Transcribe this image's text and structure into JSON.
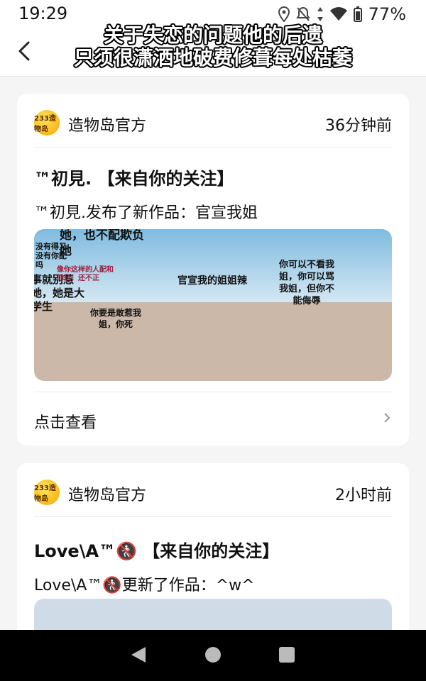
{
  "status": {
    "time": "19:29",
    "battery": "77%"
  },
  "header": {
    "title_line1": "关于失恋的问题他的后遗",
    "title_line2": "只须很潇洒地破费修葺每处枯萎"
  },
  "cards": [
    {
      "source": "造物岛官方",
      "avatar_text": "233造物岛",
      "time": "36分钟前",
      "title": "™初見. 【来自你的关注】",
      "desc": "™初見.发布了新作品：官宣我姐",
      "thumb_texts": [
        "她，也不配欺负她",
        "没有得又没有你配吗",
        "事就别惹她，她是大学生",
        "像你这样的人配和你玩，还不正",
        "你要是敢惹我姐，你死",
        "官宣我的姐姐辣",
        "你可以不看我姐，你可以骂我姐，但你不能侮辱"
      ],
      "action": "点击查看"
    },
    {
      "source": "造物岛官方",
      "avatar_text": "233造物岛",
      "time": "2小时前",
      "title": "Love\\A™🚷 【来自你的关注】",
      "desc": "Love\\A™🚷更新了作品：^w^"
    }
  ]
}
